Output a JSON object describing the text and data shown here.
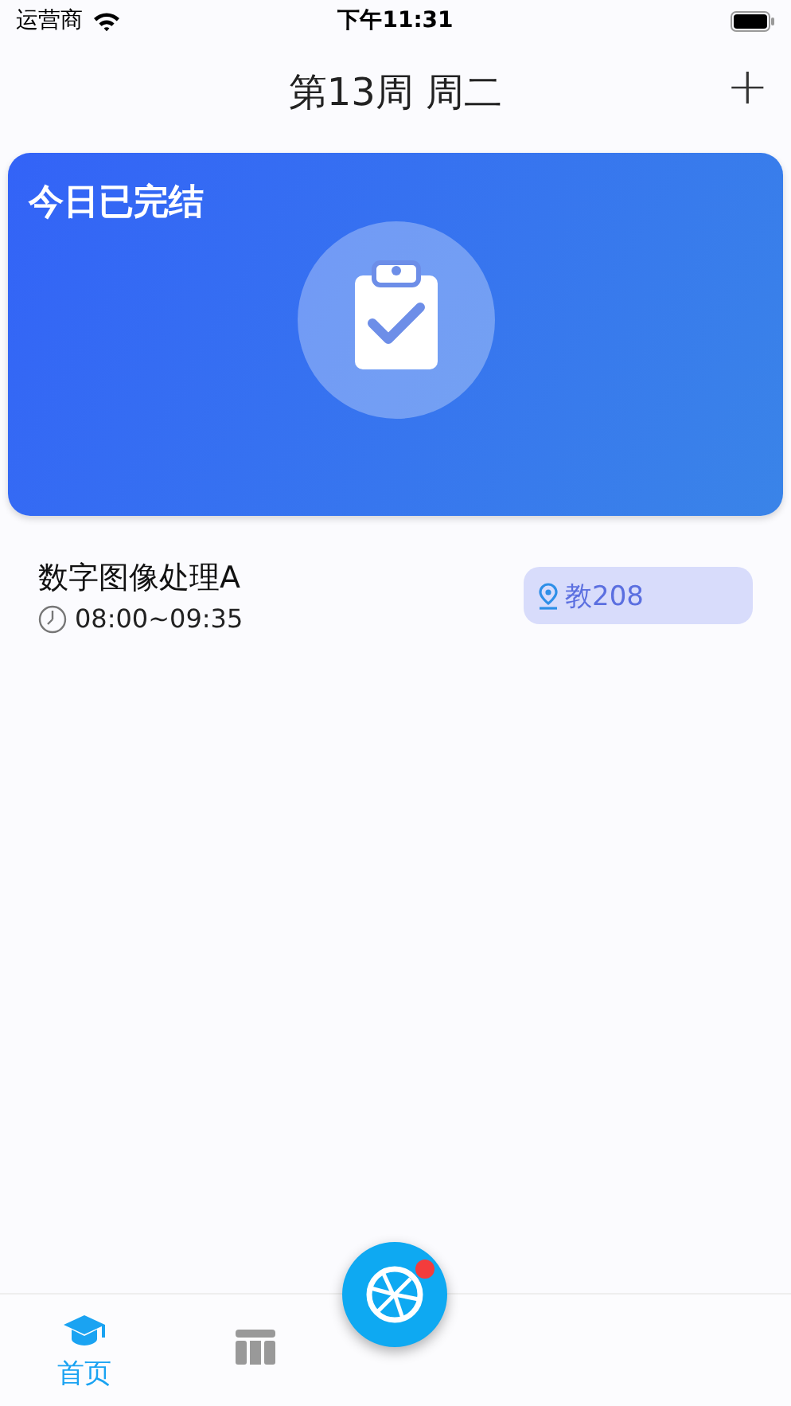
{
  "status_bar": {
    "carrier": "运营商",
    "time": "下午11:31"
  },
  "nav": {
    "title": "第13周 周二",
    "add": "+"
  },
  "banner": {
    "title": "今日已完结"
  },
  "courses": [
    {
      "name": "数字图像处理A",
      "time": "08:00~09:35",
      "room": "教208"
    }
  ],
  "tabs": [
    {
      "kind": "home",
      "label": "首页",
      "selected": true
    },
    {
      "kind": "table",
      "selected": false
    }
  ],
  "fab": {
    "badge": true
  }
}
